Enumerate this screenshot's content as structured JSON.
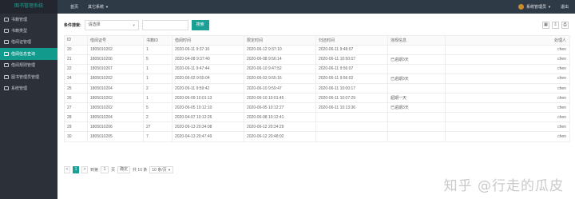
{
  "brand": {
    "title": "图书管理系统"
  },
  "topnav": {
    "home": "首页",
    "system": "其它系统"
  },
  "user": {
    "name": "系统管理员",
    "logout": "退出"
  },
  "sidebar": {
    "items": [
      {
        "label": "书籍管理",
        "active": false
      },
      {
        "label": "书籍类型",
        "active": false
      },
      {
        "label": "借阅证管理",
        "active": false
      },
      {
        "label": "借阅信息查询",
        "active": true
      },
      {
        "label": "借阅规则管理",
        "active": false
      },
      {
        "label": "图书管理员管理",
        "active": false
      },
      {
        "label": "系统管理",
        "active": false
      }
    ]
  },
  "search": {
    "label": "条件搜索:",
    "select_placeholder": "请选择",
    "button": "搜索"
  },
  "tools": {
    "columns": "▦",
    "export": "⇩",
    "print": "⎙"
  },
  "table": {
    "headers": [
      "ID",
      "借阅证号",
      "书籍ID",
      "借阅时间",
      "限定时间",
      "归还时间",
      "违规信息",
      "处理人"
    ],
    "rows": [
      [
        "20",
        "1805010202",
        "1",
        "2020-06-11 9:37:10",
        "2020-06-12 9:37:10",
        "2020-06-11 9:48:07",
        "",
        "chen"
      ],
      [
        "21",
        "1805010206",
        "5",
        "2020-04-08 9:37:40",
        "2020-06-08 9:56:14",
        "2020-06-11 10:50:07",
        "已逾期3天",
        "chen"
      ],
      [
        "22",
        "1805010207",
        "1",
        "2020-06-11 9:47:44",
        "2020-06-10 9:47:52",
        "2020-06-11 9:56:07",
        "",
        "chen"
      ],
      [
        "24",
        "1805010202",
        "1",
        "2020-06-02 9:55:04",
        "2020-06-03 9:55:16",
        "2020-06-11 9:56:02",
        "已逾期3天",
        "chen"
      ],
      [
        "25",
        "1805010204",
        "2",
        "2020-06-11 9:59:42",
        "2020-06-10 9:59:47",
        "2020-06-11 10:00:17",
        "",
        "chen"
      ],
      [
        "26",
        "1805010202",
        "1",
        "2020-06-09 10:01:13",
        "2020-06-10 10:01:45",
        "2020-06-11 10:07:29",
        "超期一天",
        "chen"
      ],
      [
        "27",
        "1805010202",
        "5",
        "2020-06-05 10:12:10",
        "2020-06-05 10:12:27",
        "2020-06-11 10:13:36",
        "已逾期3天",
        "chen"
      ],
      [
        "28",
        "1805010204",
        "2",
        "2020-04-07 10:12:26",
        "2020-06-08 10:12:41",
        "",
        "",
        "chen"
      ],
      [
        "29",
        "1805010206",
        "27",
        "2020-06-13 20:34:08",
        "2020-06-12 20:34:29",
        "",
        "",
        "chen"
      ],
      [
        "30",
        "1805010205",
        "7",
        "2020-04-13 20:47:49",
        "2020-06-12 20:48:02",
        "",
        "",
        "chen"
      ]
    ]
  },
  "pager": {
    "prev": "<",
    "current": "1",
    "next": ">",
    "goto_label": "到第",
    "goto_value": "1",
    "page_unit": "页",
    "confirm": "确定",
    "total": "共 10 条",
    "page_size": "10 条/页"
  },
  "watermark": {
    "text": "知乎 @行走的瓜皮"
  }
}
